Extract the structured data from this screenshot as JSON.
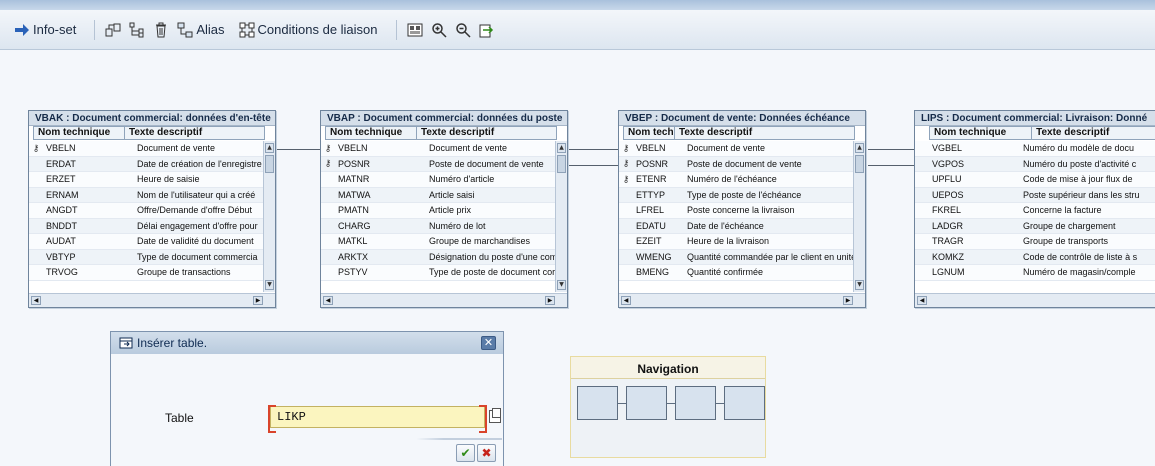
{
  "toolbar": {
    "infoset_label": "Info-set",
    "alias_label": "Alias",
    "conditions_label": "Conditions de liaison",
    "icons": [
      "arrow-right-icon",
      "table-add-icon",
      "table-hierarchy-icon",
      "delete-icon",
      "alias-icon",
      "join-conditions-icon",
      "overview-icon",
      "zoom-in-icon",
      "zoom-out-icon",
      "export-icon"
    ]
  },
  "headers": {
    "col1": "Nom technique",
    "col2": "Texte descriptif"
  },
  "tables": [
    {
      "title": "VBAK : Document commercial: données d'en-tête",
      "rows": [
        {
          "key": true,
          "name": "VBELN",
          "desc": "Document de vente"
        },
        {
          "key": false,
          "name": "ERDAT",
          "desc": "Date de création de l'enregistre"
        },
        {
          "key": false,
          "name": "ERZET",
          "desc": "Heure de saisie"
        },
        {
          "key": false,
          "name": "ERNAM",
          "desc": "Nom de l'utilisateur qui a créé"
        },
        {
          "key": false,
          "name": "ANGDT",
          "desc": "Offre/Demande d'offre Début"
        },
        {
          "key": false,
          "name": "BNDDT",
          "desc": "Délai engagement d'offre pour"
        },
        {
          "key": false,
          "name": "AUDAT",
          "desc": "Date de validité du document"
        },
        {
          "key": false,
          "name": "VBTYP",
          "desc": "Type de document commercia"
        },
        {
          "key": false,
          "name": "TRVOG",
          "desc": "Groupe de transactions"
        }
      ]
    },
    {
      "title": "VBAP : Document commercial: données du poste",
      "rows": [
        {
          "key": true,
          "name": "VBELN",
          "desc": "Document de vente"
        },
        {
          "key": true,
          "name": "POSNR",
          "desc": "Poste de document de vente"
        },
        {
          "key": false,
          "name": "MATNR",
          "desc": "Numéro d'article"
        },
        {
          "key": false,
          "name": "MATWA",
          "desc": "Article saisi"
        },
        {
          "key": false,
          "name": "PMATN",
          "desc": "Article prix"
        },
        {
          "key": false,
          "name": "CHARG",
          "desc": "Numéro de lot"
        },
        {
          "key": false,
          "name": "MATKL",
          "desc": "Groupe de marchandises"
        },
        {
          "key": false,
          "name": "ARKTX",
          "desc": "Désignation du poste d'une com"
        },
        {
          "key": false,
          "name": "PSTYV",
          "desc": "Type de poste de document cor"
        }
      ]
    },
    {
      "title": "VBEP : Document de vente: Données échéance",
      "rows": [
        {
          "key": true,
          "name": "VBELN",
          "desc": "Document de vente"
        },
        {
          "key": true,
          "name": "POSNR",
          "desc": "Poste de document de vente"
        },
        {
          "key": true,
          "name": "ETENR",
          "desc": "Numéro de l'échéance"
        },
        {
          "key": false,
          "name": "ETTYP",
          "desc": "Type de poste de l'échéance"
        },
        {
          "key": false,
          "name": "LFREL",
          "desc": "Poste concerne la livraison"
        },
        {
          "key": false,
          "name": "EDATU",
          "desc": "Date de l'échéance"
        },
        {
          "key": false,
          "name": "EZEIT",
          "desc": "Heure de la livraison"
        },
        {
          "key": false,
          "name": "WMENG",
          "desc": "Quantité commandée par le client en unité d"
        },
        {
          "key": false,
          "name": "BMENG",
          "desc": "Quantité confirmée"
        }
      ]
    },
    {
      "title": "LIPS : Document commercial: Livraison: Donné",
      "rows": [
        {
          "key": false,
          "name": "VGBEL",
          "desc": "Numéro du modèle de docu"
        },
        {
          "key": false,
          "name": "VGPOS",
          "desc": "Numéro du poste d'activité c"
        },
        {
          "key": false,
          "name": "UPFLU",
          "desc": "Code de mise à jour flux de"
        },
        {
          "key": false,
          "name": "UEPOS",
          "desc": "Poste supérieur dans les stru"
        },
        {
          "key": false,
          "name": "FKREL",
          "desc": "Concerne la facture"
        },
        {
          "key": false,
          "name": "LADGR",
          "desc": "Groupe de chargement"
        },
        {
          "key": false,
          "name": "TRAGR",
          "desc": "Groupe de transports"
        },
        {
          "key": false,
          "name": "KOMKZ",
          "desc": "Code de contrôle de liste à s"
        },
        {
          "key": false,
          "name": "LGNUM",
          "desc": "Numéro de magasin/comple"
        }
      ]
    }
  ],
  "dialog": {
    "title": "Insérer table.",
    "label": "Table",
    "value": "LIKP"
  },
  "navigation": {
    "title": "Navigation"
  }
}
